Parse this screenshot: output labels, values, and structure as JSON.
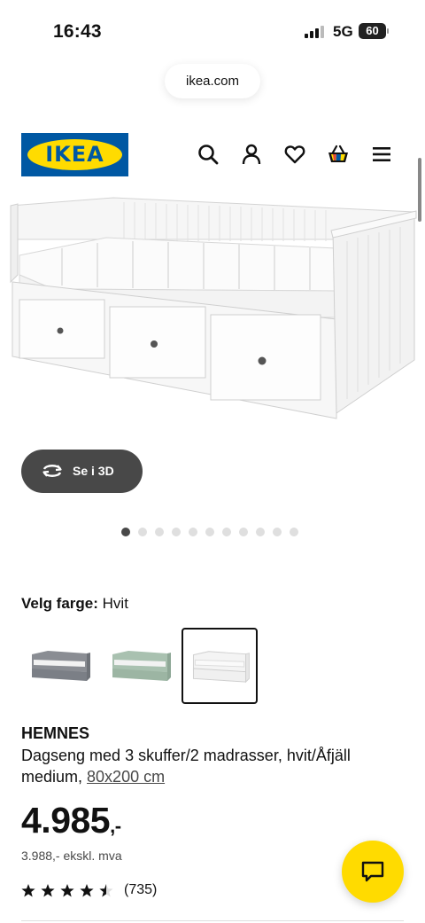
{
  "status_bar": {
    "time": "16:43",
    "network": "5G",
    "battery": "60"
  },
  "browser": {
    "url": "ikea.com"
  },
  "header": {
    "logo_text": "IKEA",
    "icons": [
      "search-icon",
      "account-icon",
      "favourites-icon",
      "basket-icon",
      "menu-icon"
    ]
  },
  "gallery": {
    "view_3d_label": "Se i 3D",
    "image_count": 11,
    "active_index": 0
  },
  "color_picker": {
    "label": "Velg farge:",
    "selected": "Hvit",
    "options": [
      "grey",
      "green",
      "white"
    ]
  },
  "product": {
    "name": "HEMNES",
    "description": "Dagseng med 3 skuffer/2 madrasser, hvit/Åfjäll medium, ",
    "size": "80x200 cm",
    "price": "4.985",
    "price_suffix": ",-",
    "price_ex_vat": "3.988,- ekskl. mva",
    "rating": 4.5,
    "review_count": "(735)"
  },
  "colors": {
    "brand_blue": "#0058a3",
    "brand_yellow": "#ffdb00",
    "dark": "#111111",
    "pill_dark": "#484848"
  }
}
